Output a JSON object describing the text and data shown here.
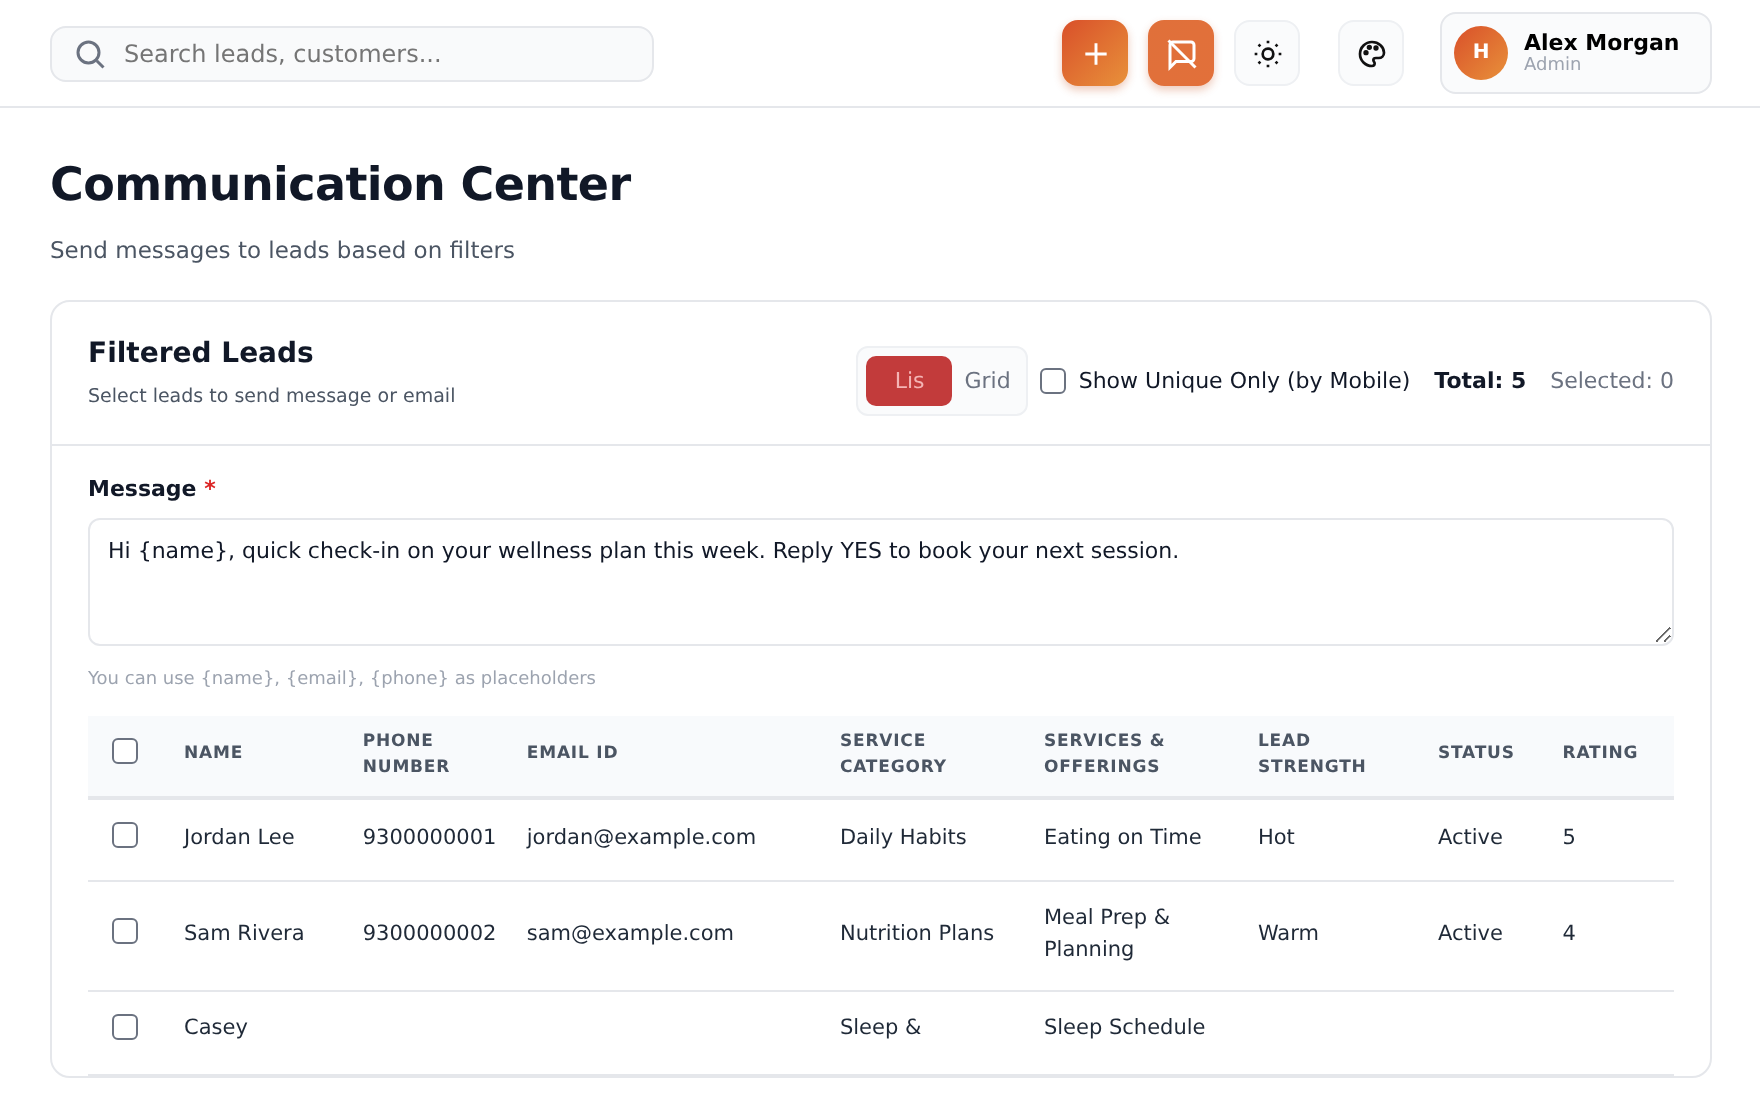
{
  "topbar": {
    "search": {
      "placeholder": "Search leads, customers..."
    },
    "user": {
      "initial": "H",
      "name": "Alex Morgan",
      "role": "Admin"
    }
  },
  "page": {
    "title": "Communication Center",
    "subtitle": "Send messages to leads based on filters"
  },
  "card": {
    "title": "Filtered Leads",
    "subtitle": "Select leads to send message or email",
    "view_toggle": [
      {
        "label": "Lis",
        "selected": true
      },
      {
        "label": "Grid",
        "selected": false
      }
    ],
    "unique_only": {
      "label": "Show Unique Only (by Mobile)",
      "checked": false
    },
    "total": "Total: 5",
    "selected_count": "Selected: 0",
    "message": {
      "label": "Message",
      "required_mark": "*",
      "value": "Hi {name}, quick check-in on your wellness plan this week. Reply YES to book your next session.",
      "hint": "You can use {name}, {email}, {phone} as placeholders"
    }
  },
  "table": {
    "select_all_checked": false,
    "columns": [
      "NAME",
      "PHONE NUMBER",
      "EMAIL ID",
      "SERVICE CATEGORY",
      "SERVICES & OFFERINGS",
      "LEAD STRENGTH",
      "STATUS",
      "RATING"
    ],
    "rows": [
      {
        "checked": false,
        "cells": [
          "Jordan Lee",
          "9300000001",
          "jordan@example.com",
          "Daily Habits",
          "Eating on Time",
          "Hot",
          "Active",
          "5"
        ]
      },
      {
        "checked": false,
        "cells": [
          "Sam Rivera",
          "9300000002",
          "sam@example.com",
          "Nutrition Plans",
          "Meal Prep & Planning",
          "Warm",
          "Active",
          "4"
        ]
      },
      {
        "checked": false,
        "cells": [
          "Casey",
          "",
          "",
          "Sleep &",
          "Sleep Schedule",
          "",
          "",
          ""
        ]
      }
    ]
  }
}
